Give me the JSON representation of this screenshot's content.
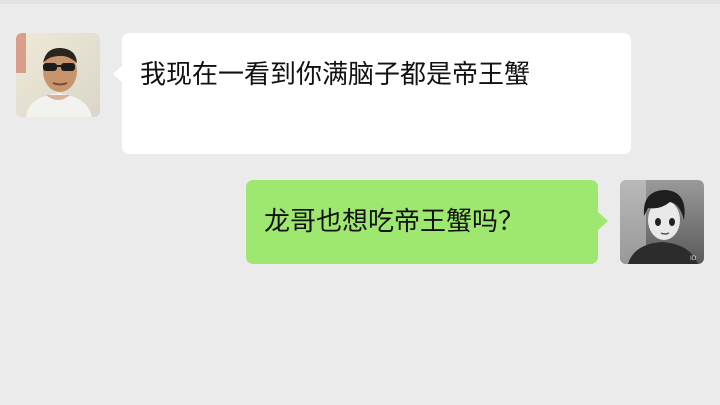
{
  "chat": {
    "messages": [
      {
        "sender": "contact",
        "text": "我现在一看到你满脑子都是帝王蟹",
        "avatar_icon": "photo-man-sunglasses-avatar-icon"
      },
      {
        "sender": "self",
        "text": "龙哥也想吃帝王蟹吗？",
        "avatar_icon": "anime-boy-avatar-icon"
      }
    ]
  },
  "colors": {
    "background": "#ebebeb",
    "incoming_bubble": "#ffffff",
    "outgoing_bubble": "#9fe870",
    "text": "#111111"
  }
}
